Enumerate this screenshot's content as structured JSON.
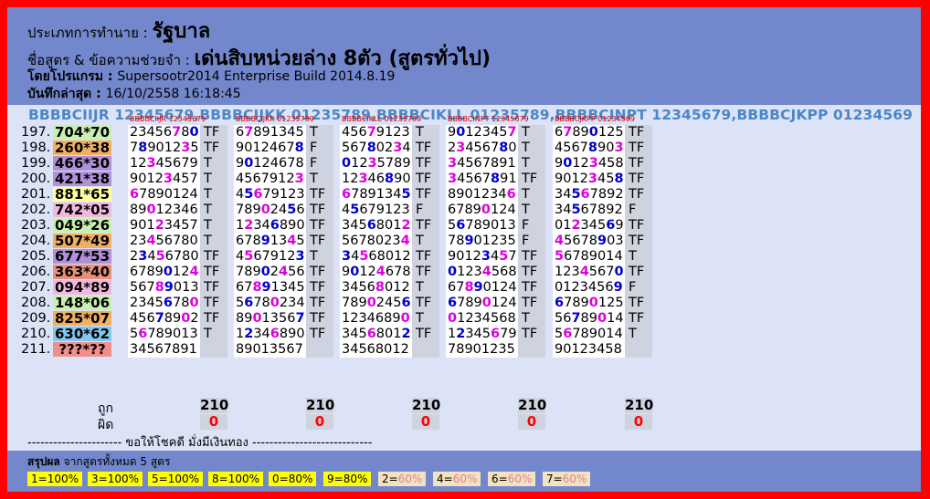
{
  "header": {
    "type_label": "ประเภทการทำนาย : ",
    "type_value": "รัฐบาล",
    "formula_label": "ชื่อสูตร & ข้อความช่วยจำ : ",
    "formula_value": "เด่นสิบหน่วยล่าง 8ตัว (สูตรทั่วไป)",
    "program_label": "โดยโปรแกรม : ",
    "program_value": "Supersootr2014 Enterprise Build 2014.8.19",
    "saved_label": "บันทึกล่าสุด : ",
    "saved_value": "16/10/2558 16:18:45"
  },
  "formula_line": "BBBBCIIJR 12345679,BBBBCIJKK 01235789,BBBBCIKLL 01235789,BBBBCINPT 12345679,BBBBCJKPP 01234569",
  "formula_headers": [
    "BBBBCIIJR 12345679",
    "BBBBCIJKK 01235789",
    "BBBBCIKLL 01235789",
    "BBBBCINPT 12345679",
    "BBBBCJKPP 01234569"
  ],
  "rows": [
    {
      "n": "197.",
      "r": "704*70",
      "bg": "#c8f0b0",
      "c": [
        [
          "23456780",
          "TF"
        ],
        [
          "67891345",
          "T"
        ],
        [
          "45679123",
          "T"
        ],
        [
          "90123457",
          "T"
        ],
        [
          "67890125",
          "TF"
        ]
      ]
    },
    {
      "n": "198.",
      "r": "260*38",
      "bg": "#f0b060",
      "c": [
        [
          "78901235",
          "TF"
        ],
        [
          "90124678",
          "F"
        ],
        [
          "56780234",
          "TF"
        ],
        [
          "23456780",
          "T"
        ],
        [
          "45678903",
          "TF"
        ]
      ]
    },
    {
      "n": "199.",
      "r": "466*30",
      "bg": "#b090d8",
      "c": [
        [
          "12345679",
          "T"
        ],
        [
          "90124678",
          "F"
        ],
        [
          "01235789",
          "TF"
        ],
        [
          "34567891",
          "T"
        ],
        [
          "90123458",
          "TF"
        ]
      ]
    },
    {
      "n": "200.",
      "r": "421*38",
      "bg": "#b090d8",
      "c": [
        [
          "90123457",
          "T"
        ],
        [
          "45679123",
          "T"
        ],
        [
          "12346890",
          "TF"
        ],
        [
          "34567891",
          "TF"
        ],
        [
          "90123458",
          "TF"
        ]
      ]
    },
    {
      "n": "201.",
      "r": "881*65",
      "bg": "#ffffa0",
      "c": [
        [
          "67890124",
          "T"
        ],
        [
          "45679123",
          "TF"
        ],
        [
          "67891345",
          "TF"
        ],
        [
          "89012346",
          "T"
        ],
        [
          "34567892",
          "TF"
        ]
      ]
    },
    {
      "n": "202.",
      "r": "742*05",
      "bg": "#f0b8e0",
      "c": [
        [
          "89012346",
          "T"
        ],
        [
          "78902456",
          "TF"
        ],
        [
          "45679123",
          "F"
        ],
        [
          "67890124",
          "T"
        ],
        [
          "34567892",
          "F"
        ]
      ]
    },
    {
      "n": "203.",
      "r": "049*26",
      "bg": "#c8f0b0",
      "c": [
        [
          "90123457",
          "T"
        ],
        [
          "12346890",
          "TF"
        ],
        [
          "34568012",
          "TF"
        ],
        [
          "56789013",
          "F"
        ],
        [
          "01234569",
          "TF"
        ]
      ]
    },
    {
      "n": "204.",
      "r": "507*49",
      "bg": "#f0b060",
      "c": [
        [
          "23456780",
          "T"
        ],
        [
          "67891345",
          "TF"
        ],
        [
          "56780234",
          "T"
        ],
        [
          "78901235",
          "F"
        ],
        [
          "45678903",
          "TF"
        ]
      ]
    },
    {
      "n": "205.",
      "r": "677*53",
      "bg": "#b090d8",
      "c": [
        [
          "23456780",
          "TF"
        ],
        [
          "45679123",
          "T"
        ],
        [
          "34568012",
          "TF"
        ],
        [
          "90123457",
          "TF"
        ],
        [
          "56789014",
          "T"
        ]
      ]
    },
    {
      "n": "206.",
      "r": "363*40",
      "bg": "#e8907a",
      "c": [
        [
          "67890124",
          "TF"
        ],
        [
          "78902456",
          "TF"
        ],
        [
          "90124678",
          "TF"
        ],
        [
          "01234568",
          "TF"
        ],
        [
          "12345670",
          "TF"
        ]
      ]
    },
    {
      "n": "207.",
      "r": "094*89",
      "bg": "#f0b8e0",
      "c": [
        [
          "56789013",
          "TF"
        ],
        [
          "67891345",
          "TF"
        ],
        [
          "34568012",
          "T"
        ],
        [
          "67890124",
          "TF"
        ],
        [
          "01234569",
          "F"
        ]
      ]
    },
    {
      "n": "208.",
      "r": "148*06",
      "bg": "#c8f0b0",
      "c": [
        [
          "23456780",
          "TF"
        ],
        [
          "56780234",
          "TF"
        ],
        [
          "78902456",
          "TF"
        ],
        [
          "67890124",
          "TF"
        ],
        [
          "67890125",
          "TF"
        ]
      ]
    },
    {
      "n": "209.",
      "r": "825*07",
      "bg": "#f0b060",
      "c": [
        [
          "45678902",
          "TF"
        ],
        [
          "89013567",
          "TF"
        ],
        [
          "12346890",
          "T"
        ],
        [
          "01234568",
          "T"
        ],
        [
          "56789014",
          "TF"
        ]
      ]
    },
    {
      "n": "210.",
      "r": "630*62",
      "bg": "#80c8f0",
      "c": [
        [
          "56789013",
          "T"
        ],
        [
          "12346890",
          "TF"
        ],
        [
          "34568012",
          "TF"
        ],
        [
          "12345679",
          "TF"
        ],
        [
          "56789014",
          "T"
        ]
      ]
    },
    {
      "n": "211.",
      "r": "???*??",
      "bg": "#f0908c",
      "c": [
        [
          "34567891",
          ""
        ],
        [
          "89013567",
          ""
        ],
        [
          "34568012",
          ""
        ],
        [
          "78901235",
          ""
        ],
        [
          "90123458",
          ""
        ]
      ]
    }
  ],
  "stats": {
    "hit_label": "ถูก",
    "miss_label": "ผิด",
    "hit_values": [
      "210",
      "210",
      "210",
      "210",
      "210"
    ],
    "miss_values": [
      "0",
      "0",
      "0",
      "0",
      "0"
    ]
  },
  "divider": "---------------------- ขอให้โชคดี มั่งมีเงินทอง ----------------------------",
  "summary": {
    "label_bold": "สรุปผล",
    "label_rest": " จากสูตรทั้งหมด 5 สูตร",
    "items": [
      {
        "k": "1",
        "v": "100%",
        "full": true
      },
      {
        "k": "3",
        "v": "100%",
        "full": true
      },
      {
        "k": "5",
        "v": "100%",
        "full": true
      },
      {
        "k": "8",
        "v": "100%",
        "full": true
      },
      {
        "k": "0",
        "v": "80%",
        "full": true
      },
      {
        "k": "9",
        "v": "80%",
        "full": true
      },
      {
        "k": "2",
        "v": "60%",
        "full": false
      },
      {
        "k": "4",
        "v": "60%",
        "full": false
      },
      {
        "k": "6",
        "v": "60%",
        "full": false
      },
      {
        "k": "7",
        "v": "60%",
        "full": false
      }
    ]
  }
}
